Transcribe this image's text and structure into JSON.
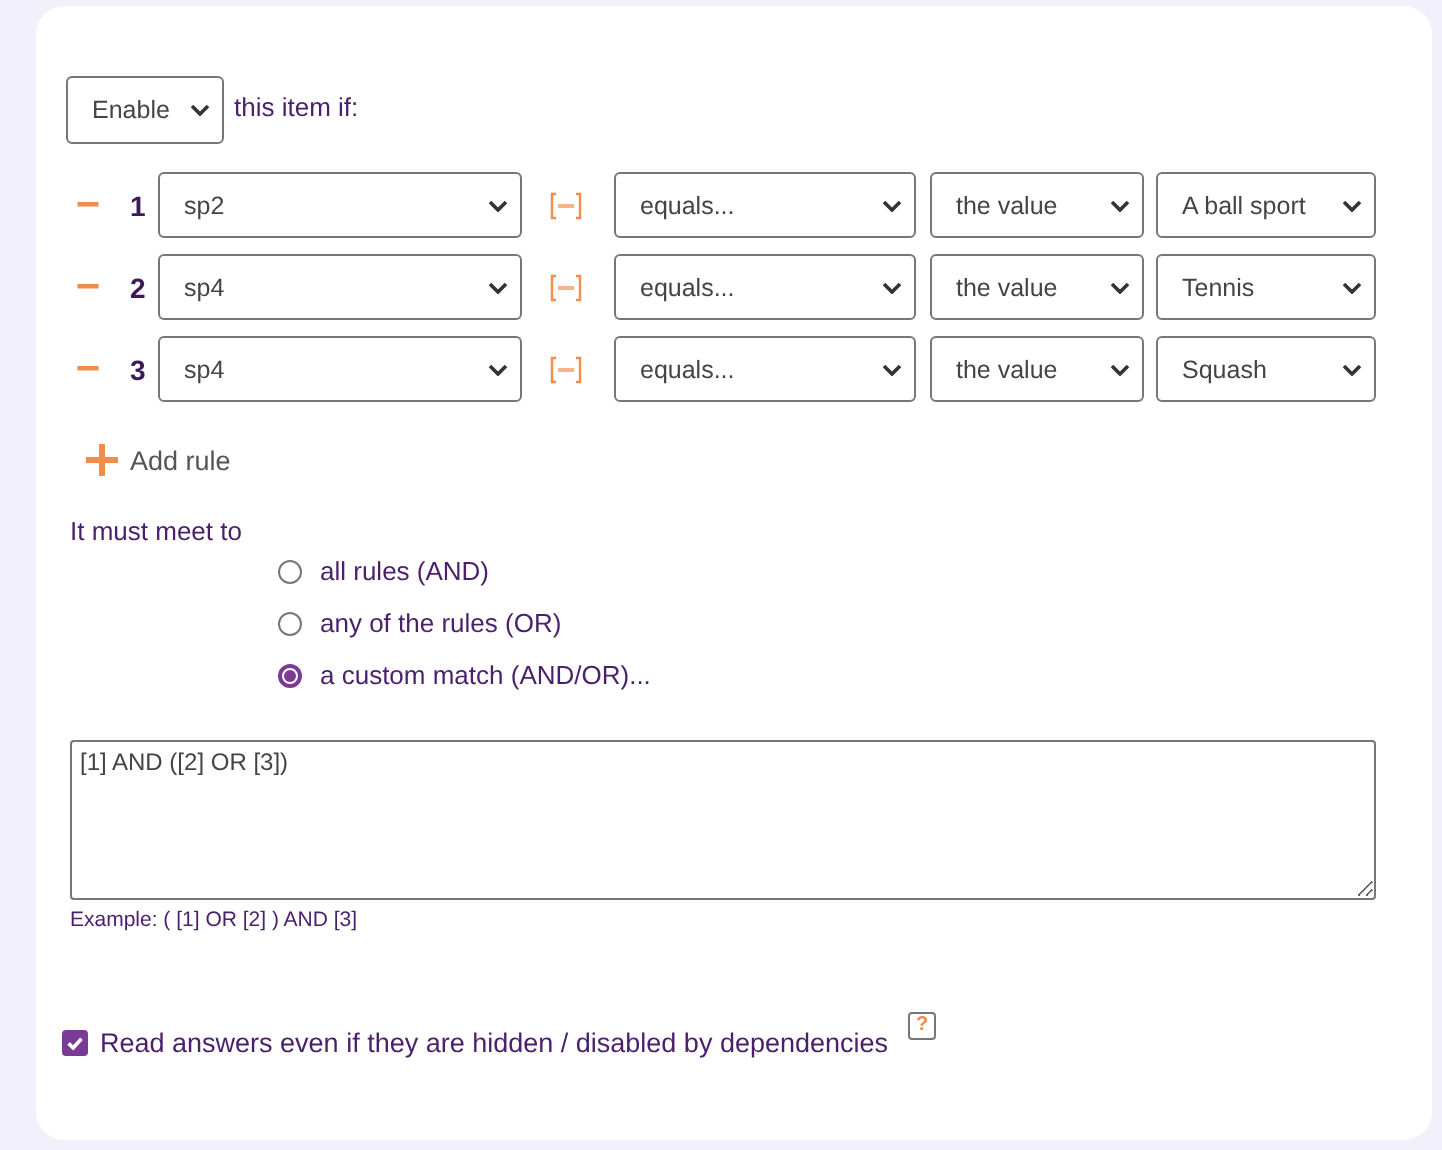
{
  "action_select": {
    "value": "Enable"
  },
  "intro": "this item if:",
  "rules": [
    {
      "number": "1",
      "field": "sp2",
      "operator": "equals...",
      "compare": "the value",
      "value": "A ball sport"
    },
    {
      "number": "2",
      "field": "sp4",
      "operator": "equals...",
      "compare": "the value",
      "value": "Tennis"
    },
    {
      "number": "3",
      "field": "sp4",
      "operator": "equals...",
      "compare": "the value",
      "value": "Squash"
    }
  ],
  "add_rule": "Add rule",
  "match_label": "It must meet to",
  "match_options": [
    {
      "label": "all rules (AND)",
      "selected": false
    },
    {
      "label": "any of the rules (OR)",
      "selected": false
    },
    {
      "label": "a custom match (AND/OR)...",
      "selected": true
    }
  ],
  "custom_expression": {
    "value": "[1] AND ([2] OR [3])"
  },
  "example": "Example: ( [1] OR [2] ) AND [3]",
  "read_hidden": {
    "label": "Read answers even if they are hidden / disabled by dependencies",
    "checked": true
  },
  "help": "?"
}
